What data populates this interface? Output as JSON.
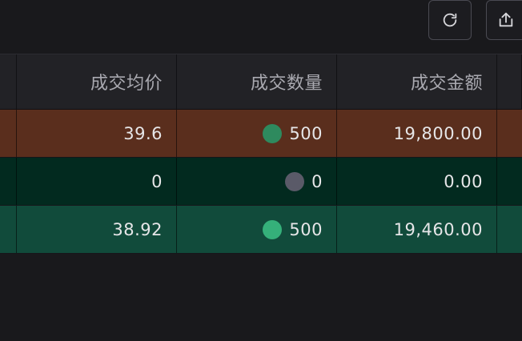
{
  "toolbar": {
    "refresh_icon": "refresh-icon",
    "export_icon": "export-icon"
  },
  "table": {
    "columns": [
      "成交均价",
      "成交数量",
      "成交金额"
    ],
    "rows": [
      {
        "avg_price": "39.6",
        "quantity": "500",
        "amount": "19,800.00",
        "bg_color": "#5a2e1d",
        "dot_color": "#2e8a5e"
      },
      {
        "avg_price": "0",
        "quantity": "0",
        "amount": "0.00",
        "bg_color": "#022a1f",
        "dot_color": "#5a5a68"
      },
      {
        "avg_price": "38.92",
        "quantity": "500",
        "amount": "19,460.00",
        "bg_color": "#114b3b",
        "dot_color": "#35b07a"
      }
    ]
  },
  "colors": {
    "background": "#19191c",
    "header_bg": "#222226"
  }
}
